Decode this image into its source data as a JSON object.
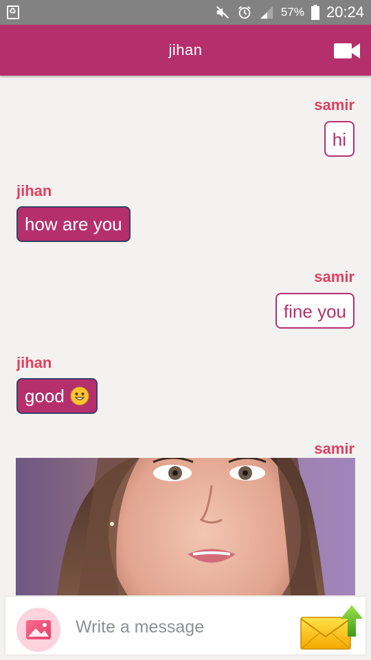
{
  "status_bar": {
    "battery_percent": "57%",
    "time": "20:24"
  },
  "header": {
    "title": "jihan",
    "video_icon": "video-camera-icon"
  },
  "messages": [
    {
      "sender": "samir",
      "text": "hi",
      "direction": "outgoing"
    },
    {
      "sender": "jihan",
      "text": "how are you",
      "direction": "incoming"
    },
    {
      "sender": "samir",
      "text": "fine you",
      "direction": "outgoing"
    },
    {
      "sender": "jihan",
      "text": "good",
      "emoji": "grinning-face",
      "direction": "incoming"
    },
    {
      "sender": "samir",
      "type": "image",
      "direction": "outgoing"
    }
  ],
  "composer": {
    "placeholder": "Write a message",
    "image_icon": "image-icon",
    "send_icon": "envelope-send-icon"
  },
  "colors": {
    "accent": "#b52f6d",
    "sender_name": "#e0405f",
    "status_bar": "#828282",
    "background": "#f3f2f0"
  }
}
